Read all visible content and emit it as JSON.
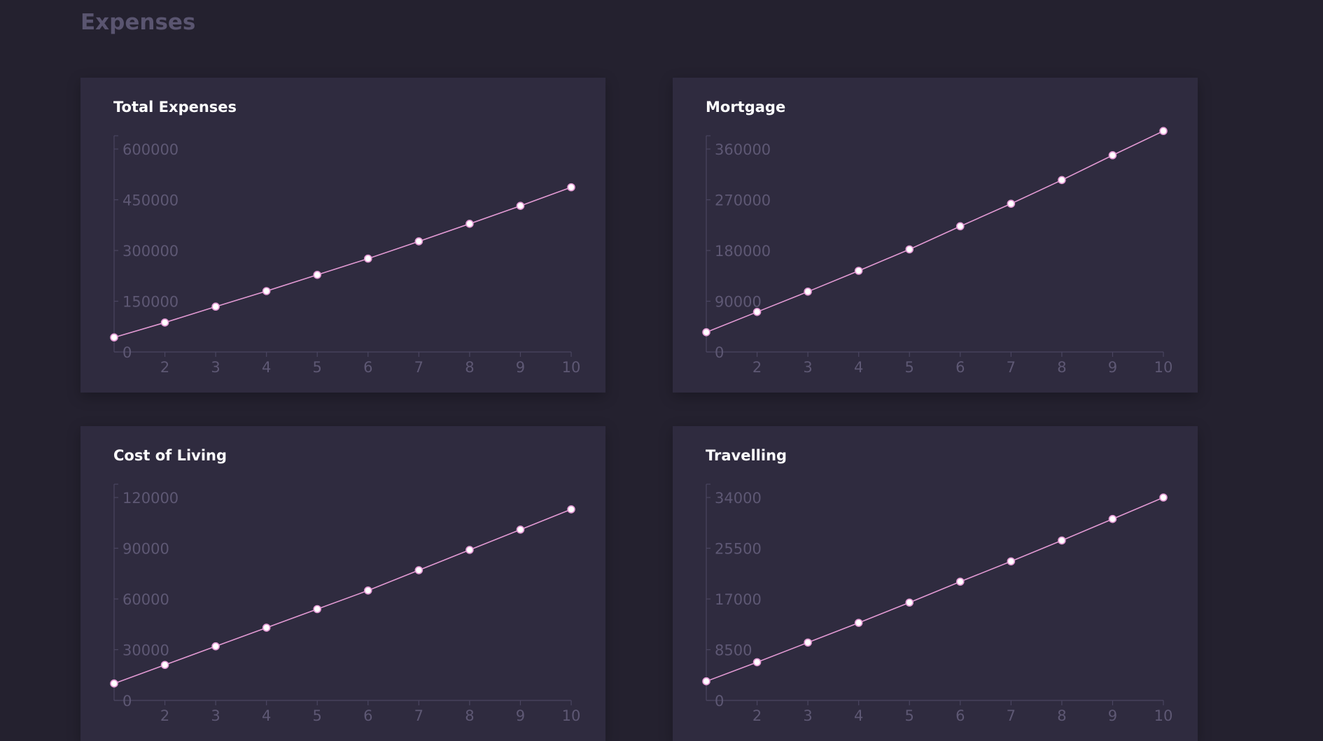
{
  "page_title": "Expenses",
  "colors": {
    "background": "#24212f",
    "card": "#2f2b3f",
    "axis": "#4a4560",
    "tick_label": "#5e5874",
    "line": "#e39ad4",
    "point_fill": "#ffffff"
  },
  "chart_data": [
    {
      "type": "line",
      "title": "Total Expenses",
      "x": [
        1,
        2,
        3,
        4,
        5,
        6,
        7,
        8,
        9,
        10
      ],
      "values": [
        43000,
        87000,
        134000,
        180000,
        228000,
        276000,
        327000,
        379000,
        432000,
        487000
      ],
      "xticks": [
        "2",
        "3",
        "4",
        "5",
        "6",
        "7",
        "8",
        "9",
        "10"
      ],
      "yticks": [
        "0",
        "150000",
        "300000",
        "450000",
        "600000"
      ],
      "ylim": [
        0,
        600000
      ],
      "grid": false
    },
    {
      "type": "line",
      "title": "Mortgage",
      "x": [
        1,
        2,
        3,
        4,
        5,
        6,
        7,
        8,
        9,
        10
      ],
      "values": [
        35000,
        71000,
        107000,
        144000,
        182000,
        223000,
        263000,
        305000,
        349000,
        392000
      ],
      "xticks": [
        "2",
        "3",
        "4",
        "5",
        "6",
        "7",
        "8",
        "9",
        "10"
      ],
      "yticks": [
        "0",
        "90000",
        "180000",
        "270000",
        "360000"
      ],
      "ylim": [
        0,
        360000
      ],
      "grid": false
    },
    {
      "type": "line",
      "title": "Cost of Living",
      "x": [
        1,
        2,
        3,
        4,
        5,
        6,
        7,
        8,
        9,
        10
      ],
      "values": [
        10000,
        21000,
        32000,
        43000,
        54000,
        65000,
        77000,
        89000,
        101000,
        113000
      ],
      "xticks": [
        "2",
        "3",
        "4",
        "5",
        "6",
        "7",
        "8",
        "9",
        "10"
      ],
      "yticks": [
        "0",
        "30000",
        "60000",
        "90000",
        "120000"
      ],
      "ylim": [
        0,
        120000
      ],
      "grid": false
    },
    {
      "type": "line",
      "title": "Travelling",
      "x": [
        1,
        2,
        3,
        4,
        5,
        6,
        7,
        8,
        9,
        10
      ],
      "values": [
        3200,
        6400,
        9700,
        13000,
        16400,
        19900,
        23300,
        26800,
        30400,
        34000
      ],
      "xticks": [
        "2",
        "3",
        "4",
        "5",
        "6",
        "7",
        "8",
        "9",
        "10"
      ],
      "yticks": [
        "0",
        "8500",
        "17000",
        "25500",
        "34000"
      ],
      "ylim": [
        0,
        34000
      ],
      "grid": false
    }
  ]
}
